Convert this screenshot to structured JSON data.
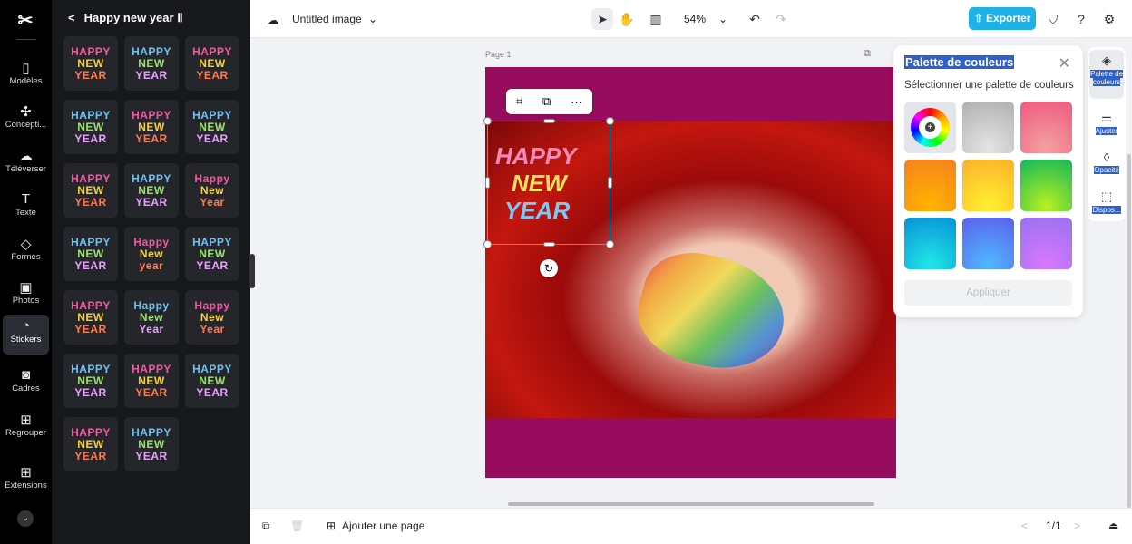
{
  "rail": {
    "items": [
      {
        "label": "Modèles",
        "icon": "template-icon"
      },
      {
        "label": "Concepti...",
        "icon": "design-icon"
      },
      {
        "label": "Téléverser",
        "icon": "upload-icon"
      },
      {
        "label": "Texte",
        "icon": "text-icon"
      },
      {
        "label": "Formes",
        "icon": "shapes-icon"
      },
      {
        "label": "Photos",
        "icon": "photos-icon"
      },
      {
        "label": "Stickers",
        "icon": "stickers-icon"
      },
      {
        "label": "Cadres",
        "icon": "frames-icon"
      },
      {
        "label": "Regrouper",
        "icon": "group-icon"
      },
      {
        "label": "Extensions",
        "icon": "extensions-icon"
      }
    ],
    "active": "Stickers"
  },
  "panel": {
    "title": "Happy new year Ⅱ",
    "stickers": [
      [
        "HAPPY",
        "NEW",
        "YEAR"
      ],
      [
        "HAPPY",
        "NEW",
        "YEAR"
      ],
      [
        "HAPPY",
        "NEW",
        "YEAR"
      ],
      [
        "HAPPY",
        "NEW",
        "YEAR"
      ],
      [
        "HAPPY",
        "NEW",
        "YEAR"
      ],
      [
        "HAPPY",
        "NEW",
        "YEAR"
      ],
      [
        "HAPPY",
        "NEW",
        "YEAR"
      ],
      [
        "HAPPY",
        "NEW",
        "YEAR"
      ],
      [
        "Happy",
        "New",
        "Year"
      ],
      [
        "HAPPY",
        "NEW",
        "YEAR"
      ],
      [
        "Happy",
        "New",
        "year"
      ],
      [
        "HAPPY",
        "NEW",
        "YEAR"
      ],
      [
        "HAPPY",
        "NEW",
        "YEAR"
      ],
      [
        "Happy",
        "New",
        "Year"
      ],
      [
        "Happy",
        "New",
        "Year"
      ],
      [
        "HAPPY",
        "NEW",
        "YEAR"
      ],
      [
        "HAPPY",
        "NEW",
        "YEAR"
      ],
      [
        "HAPPY",
        "NEW",
        "YEAR"
      ],
      [
        "HAPPY",
        "NEW",
        "YEAR"
      ],
      [
        "HAPPY",
        "NEW",
        "YEAR"
      ]
    ]
  },
  "topbar": {
    "doc_title": "Untitled image",
    "zoom": "54%",
    "export_label": "Exporter"
  },
  "canvas": {
    "page_label": "Page 1",
    "sticker": [
      "HAPPY",
      "NEW",
      "YEAR"
    ],
    "page_color": "#980c5e"
  },
  "palette": {
    "title": "Palette de couleurs",
    "subtitle": "Sélectionner une palette de couleurs",
    "apply_label": "Appliquer",
    "swatches": [
      "custom",
      "#bdbdbd",
      "#f06b7e",
      "#f7941d",
      "#fcd32a",
      "#27c24c",
      "#12b8e0",
      "#5b7cf5",
      "#b26cf5"
    ]
  },
  "side_tools": [
    {
      "label": "Palette de couleurs",
      "icon": "paint-bucket-icon"
    },
    {
      "label": "Ajuster",
      "icon": "sliders-icon"
    },
    {
      "label": "Opacité",
      "icon": "droplet-icon"
    },
    {
      "label": "Dispos...",
      "icon": "arrange-icon"
    }
  ],
  "bottombar": {
    "add_page_label": "Ajouter une page",
    "page_count": "1/1"
  }
}
